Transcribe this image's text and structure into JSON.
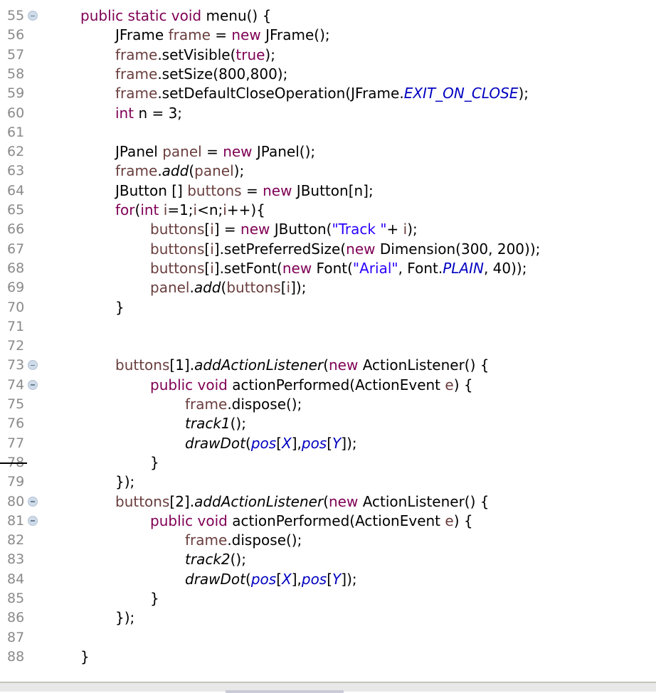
{
  "editor": {
    "language": "Java",
    "lines": [
      {
        "n": "55",
        "fold": true,
        "indent": 0,
        "tokens": [
          [
            "kw",
            "public static void "
          ],
          [
            "",
            "menu() {"
          ]
        ]
      },
      {
        "n": "56",
        "fold": false,
        "indent": 1,
        "tokens": [
          [
            "",
            "JFrame "
          ],
          [
            "lv",
            "frame"
          ],
          [
            "",
            " = "
          ],
          [
            "kw",
            "new "
          ],
          [
            "",
            "JFrame();"
          ]
        ]
      },
      {
        "n": "57",
        "fold": false,
        "indent": 1,
        "tokens": [
          [
            "lv",
            "frame"
          ],
          [
            "",
            ".setVisible("
          ],
          [
            "kw",
            "true"
          ],
          [
            "",
            ");"
          ]
        ]
      },
      {
        "n": "58",
        "fold": false,
        "indent": 1,
        "tokens": [
          [
            "lv",
            "frame"
          ],
          [
            "",
            ".setSize(800,800);"
          ]
        ]
      },
      {
        "n": "59",
        "fold": false,
        "indent": 1,
        "tokens": [
          [
            "lv",
            "frame"
          ],
          [
            "",
            ".setDefaultCloseOperation(JFrame."
          ],
          [
            "cst",
            "EXIT_ON_CLOSE"
          ],
          [
            "",
            ");"
          ]
        ]
      },
      {
        "n": "60",
        "fold": false,
        "indent": 1,
        "tokens": [
          [
            "kw",
            "int "
          ],
          [
            "",
            "n = 3;"
          ]
        ]
      },
      {
        "n": "61",
        "fold": false,
        "indent": 0,
        "tokens": []
      },
      {
        "n": "62",
        "fold": false,
        "indent": 1,
        "tokens": [
          [
            "",
            "JPanel "
          ],
          [
            "lv",
            "panel"
          ],
          [
            "",
            " = "
          ],
          [
            "kw",
            "new "
          ],
          [
            "",
            "JPanel();"
          ]
        ]
      },
      {
        "n": "63",
        "fold": false,
        "indent": 1,
        "tokens": [
          [
            "lv",
            "frame"
          ],
          [
            "",
            "."
          ],
          [
            "it",
            "add"
          ],
          [
            "",
            "("
          ],
          [
            "lv",
            "panel"
          ],
          [
            "",
            ");"
          ]
        ]
      },
      {
        "n": "64",
        "fold": false,
        "indent": 1,
        "tokens": [
          [
            "",
            "JButton [] "
          ],
          [
            "lv",
            "buttons"
          ],
          [
            "",
            " = "
          ],
          [
            "kw",
            "new "
          ],
          [
            "",
            "JButton[n];"
          ]
        ]
      },
      {
        "n": "65",
        "fold": false,
        "indent": 1,
        "tokens": [
          [
            "kw",
            "for"
          ],
          [
            "",
            "("
          ],
          [
            "kw",
            "int "
          ],
          [
            "lv",
            "i"
          ],
          [
            "",
            "=1;"
          ],
          [
            "lv",
            "i"
          ],
          [
            "",
            "<n;"
          ],
          [
            "lv",
            "i"
          ],
          [
            "",
            "++){"
          ]
        ]
      },
      {
        "n": "66",
        "fold": false,
        "indent": 2,
        "tokens": [
          [
            "lv",
            "buttons"
          ],
          [
            "",
            "["
          ],
          [
            "lv",
            "i"
          ],
          [
            "",
            "] = "
          ],
          [
            "kw",
            "new "
          ],
          [
            "",
            "JButton("
          ],
          [
            "str",
            "\"Track \""
          ],
          [
            "",
            "+ "
          ],
          [
            "lv",
            "i"
          ],
          [
            "",
            ");"
          ]
        ]
      },
      {
        "n": "67",
        "fold": false,
        "indent": 2,
        "tokens": [
          [
            "lv",
            "buttons"
          ],
          [
            "",
            "["
          ],
          [
            "lv",
            "i"
          ],
          [
            "",
            "].setPreferredSize("
          ],
          [
            "kw",
            "new "
          ],
          [
            "",
            "Dimension(300, 200));"
          ]
        ]
      },
      {
        "n": "68",
        "fold": false,
        "indent": 2,
        "tokens": [
          [
            "lv",
            "buttons"
          ],
          [
            "",
            "["
          ],
          [
            "lv",
            "i"
          ],
          [
            "",
            "].setFont("
          ],
          [
            "kw",
            "new "
          ],
          [
            "",
            "Font("
          ],
          [
            "str",
            "\"Arial\""
          ],
          [
            "",
            ", Font."
          ],
          [
            "cst",
            "PLAIN"
          ],
          [
            "",
            ", 40));"
          ]
        ]
      },
      {
        "n": "69",
        "fold": false,
        "indent": 2,
        "tokens": [
          [
            "lv",
            "panel"
          ],
          [
            "",
            "."
          ],
          [
            "it",
            "add"
          ],
          [
            "",
            "("
          ],
          [
            "lv",
            "buttons"
          ],
          [
            "",
            "["
          ],
          [
            "lv",
            "i"
          ],
          [
            "",
            "]);"
          ]
        ]
      },
      {
        "n": "70",
        "fold": false,
        "indent": 1,
        "tokens": [
          [
            "",
            "}"
          ]
        ]
      },
      {
        "n": "71",
        "fold": false,
        "indent": 0,
        "tokens": []
      },
      {
        "n": "72",
        "fold": false,
        "indent": 0,
        "tokens": []
      },
      {
        "n": "73",
        "fold": true,
        "indent": 1,
        "tokens": [
          [
            "lv",
            "buttons"
          ],
          [
            "",
            "[1]."
          ],
          [
            "it",
            "addActionListener"
          ],
          [
            "",
            "("
          ],
          [
            "kw",
            "new "
          ],
          [
            "",
            "ActionListener() {"
          ]
        ]
      },
      {
        "n": "74",
        "fold": true,
        "indent": 2,
        "tokens": [
          [
            "kw",
            "public void "
          ],
          [
            "",
            "actionPerformed(ActionEvent "
          ],
          [
            "lv",
            "e"
          ],
          [
            "",
            ") {"
          ]
        ]
      },
      {
        "n": "75",
        "fold": false,
        "indent": 3,
        "tokens": [
          [
            "lv",
            "frame"
          ],
          [
            "",
            ".dispose();"
          ]
        ]
      },
      {
        "n": "76",
        "fold": false,
        "indent": 3,
        "tokens": [
          [
            "it",
            "track1"
          ],
          [
            "",
            "();"
          ]
        ]
      },
      {
        "n": "77",
        "fold": false,
        "indent": 3,
        "tokens": [
          [
            "it",
            "drawDot"
          ],
          [
            "",
            "("
          ],
          [
            "fldi",
            "pos"
          ],
          [
            "",
            "["
          ],
          [
            "cst",
            "X"
          ],
          [
            "",
            "],"
          ],
          [
            "fldi",
            "pos"
          ],
          [
            "",
            "["
          ],
          [
            "cst",
            "Y"
          ],
          [
            "",
            "]);"
          ]
        ]
      },
      {
        "n": "78",
        "fold": false,
        "indent": 2,
        "tokens": [
          [
            "",
            "}"
          ]
        ]
      },
      {
        "n": "79",
        "fold": false,
        "indent": 1,
        "tokens": [
          [
            "",
            "});"
          ]
        ]
      },
      {
        "n": "80",
        "fold": true,
        "indent": 1,
        "tokens": [
          [
            "lv",
            "buttons"
          ],
          [
            "",
            "[2]."
          ],
          [
            "it",
            "addActionListener"
          ],
          [
            "",
            "("
          ],
          [
            "kw",
            "new "
          ],
          [
            "",
            "ActionListener() {"
          ]
        ]
      },
      {
        "n": "81",
        "fold": true,
        "indent": 2,
        "tokens": [
          [
            "kw",
            "public void "
          ],
          [
            "",
            "actionPerformed(ActionEvent "
          ],
          [
            "lv",
            "e"
          ],
          [
            "",
            ") {"
          ]
        ]
      },
      {
        "n": "82",
        "fold": false,
        "indent": 3,
        "tokens": [
          [
            "lv",
            "frame"
          ],
          [
            "",
            ".dispose();"
          ]
        ]
      },
      {
        "n": "83",
        "fold": false,
        "indent": 3,
        "tokens": [
          [
            "it",
            "track2"
          ],
          [
            "",
            "();"
          ]
        ]
      },
      {
        "n": "84",
        "fold": false,
        "indent": 3,
        "tokens": [
          [
            "it",
            "drawDot"
          ],
          [
            "",
            "("
          ],
          [
            "fldi",
            "pos"
          ],
          [
            "",
            "["
          ],
          [
            "cst",
            "X"
          ],
          [
            "",
            "],"
          ],
          [
            "fldi",
            "pos"
          ],
          [
            "",
            "["
          ],
          [
            "cst",
            "Y"
          ],
          [
            "",
            "]);"
          ]
        ]
      },
      {
        "n": "85",
        "fold": false,
        "indent": 2,
        "tokens": [
          [
            "",
            "}"
          ]
        ]
      },
      {
        "n": "86",
        "fold": false,
        "indent": 1,
        "tokens": [
          [
            "",
            "});"
          ]
        ]
      },
      {
        "n": "87",
        "fold": false,
        "indent": 0,
        "tokens": []
      },
      {
        "n": "88",
        "fold": false,
        "indent": 0,
        "tokens": [
          [
            "",
            "}"
          ]
        ]
      }
    ]
  },
  "colors": {
    "keyword": "#7f0055",
    "local_variable": "#6a3e3e",
    "string": "#2a00ff",
    "static_constant": "#0000c0",
    "line_number": "#8a8a8a"
  }
}
